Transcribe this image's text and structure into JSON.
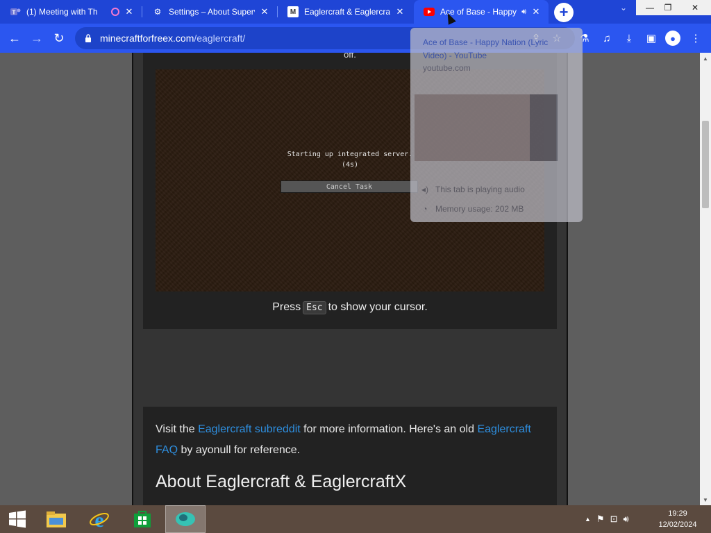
{
  "browser": {
    "tabs": [
      {
        "title": "(1) Meeting with Th",
        "icon": "teams-icon",
        "active": false
      },
      {
        "title": "Settings – About Superv",
        "icon": "gear-icon",
        "active": false
      },
      {
        "title": "Eaglercraft & Eaglercraf",
        "icon": "m-logo-icon",
        "active": false
      },
      {
        "title": "Ace of Base - Happy",
        "icon": "youtube-icon",
        "active": true
      }
    ],
    "url_host": "minecraftforfreex.com",
    "url_path": "/eaglercraft/"
  },
  "game": {
    "top_text": "off.",
    "status_line1": "Starting up integrated server.",
    "status_line2": "(4s)",
    "cancel_label": "Cancel Task",
    "press_before": "Press",
    "press_key": "Esc",
    "press_after": "to show your cursor."
  },
  "info": {
    "visit": "Visit the",
    "subreddit_link": "Eaglercraft subreddit",
    "more_info": "for more information. Here's an old",
    "faq_link_1": "Eaglercraft",
    "faq_link_2": "FAQ",
    "by_ayonull": "by ayonull for reference.",
    "heading": "About Eaglercraft & EaglercraftX"
  },
  "hover_card": {
    "title": "Ace of Base - Happy Nation (Lyric Video) - YouTube",
    "domain": "youtube.com",
    "audio": "This tab is playing audio",
    "memory": "Memory usage: 202 MB"
  },
  "taskbar": {
    "time": "19:29",
    "date": "12/02/2024"
  },
  "colors": {
    "tabstrip": "#1f45d6",
    "toolbar": "#2b56f0",
    "link": "#2e8fe0"
  }
}
